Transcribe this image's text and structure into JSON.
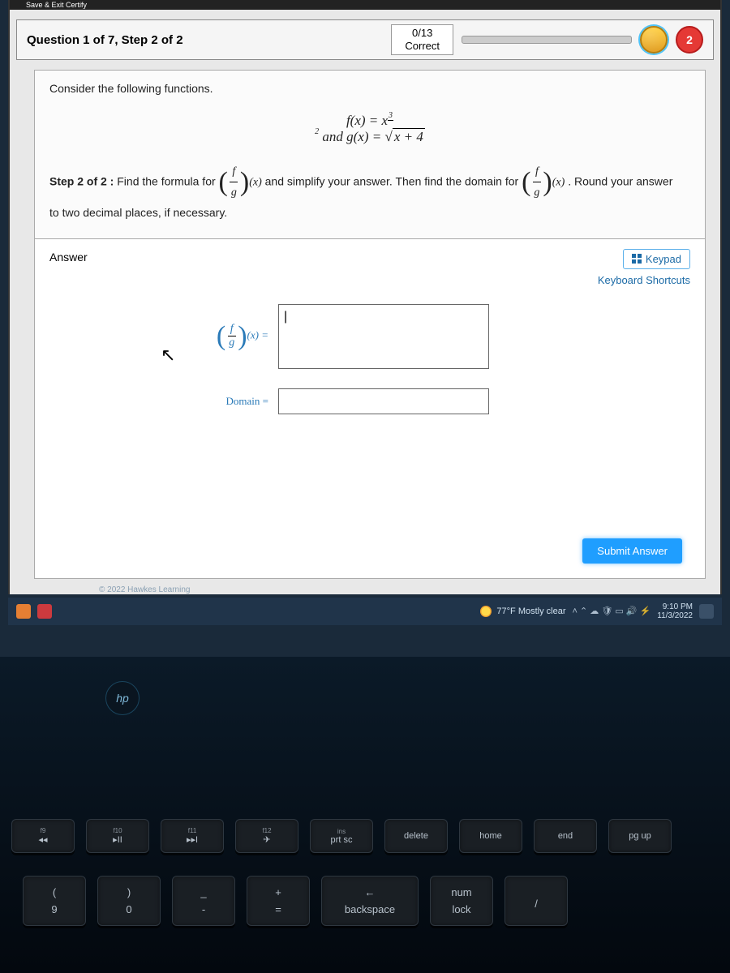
{
  "topbar_fragment": "Save & Exit Certify",
  "header": {
    "title": "Question 1 of 7, Step 2 of 2",
    "score_top": "0/13",
    "score_bottom": "Correct",
    "heart_count": "2"
  },
  "problem": {
    "intro": "Consider the following functions.",
    "f_lhs": "f(x) = x",
    "f_exp_num": "3",
    "f_exp_den": "2",
    "and": " and ",
    "g_lhs": "g(x) = ",
    "g_radicand": "x + 4",
    "step_prefix": "Step 2 of 2 :",
    "step_a": " Find the formula for ",
    "frac_f": "f",
    "frac_g": "g",
    "of_x": "(x)",
    "step_b": " and simplify your answer. Then find the domain for ",
    "step_c": ". Round your answer",
    "step_tail": "to two decimal places, if necessary."
  },
  "answer": {
    "heading": "Answer",
    "keypad": "Keypad",
    "shortcuts": "Keyboard Shortcuts",
    "row1_suffix": "(x) =",
    "row2_label": "Domain =",
    "input1_value": "|",
    "input2_value": "",
    "submit": "Submit Answer"
  },
  "copyright": "© 2022 Hawkes Learning",
  "taskbar": {
    "weather": "77°F  Mostly clear",
    "time": "9:10 PM",
    "date": "11/3/2022"
  },
  "keyboard": {
    "hp": "hp",
    "row1": [
      {
        "sub": "f9",
        "main": "◂◂"
      },
      {
        "sub": "f10",
        "main": "▸II"
      },
      {
        "sub": "f11",
        "main": "▸▸I"
      },
      {
        "sub": "f12",
        "main": "✈"
      },
      {
        "sub": "ins",
        "main": "prt sc"
      },
      {
        "sub": "",
        "main": "delete"
      },
      {
        "sub": "",
        "main": "home"
      },
      {
        "sub": "",
        "main": "end"
      },
      {
        "sub": "",
        "main": "pg up"
      }
    ],
    "row2": [
      {
        "top": "(",
        "bot": "9"
      },
      {
        "top": ")",
        "bot": "0"
      },
      {
        "top": "_",
        "bot": "-"
      },
      {
        "top": "+",
        "bot": "="
      },
      {
        "top": "←",
        "bot": "backspace",
        "wide": true
      },
      {
        "top": "num",
        "bot": "lock"
      },
      {
        "top": "",
        "bot": "/"
      }
    ]
  }
}
